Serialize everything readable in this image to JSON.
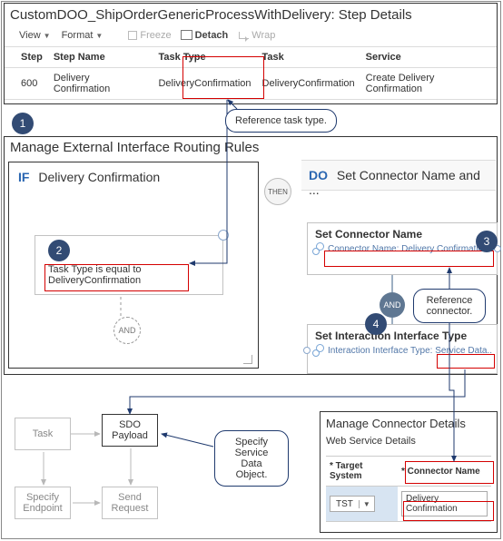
{
  "top": {
    "title": "CustomDOO_ShipOrderGenericProcessWithDelivery: Step Details",
    "toolbar": {
      "view": "View",
      "format": "Format",
      "freeze": "Freeze",
      "detach": "Detach",
      "wrap": "Wrap"
    },
    "table": {
      "headers": {
        "step": "Step",
        "step_name": "Step Name",
        "task_type": "Task Type",
        "task": "Task",
        "service": "Service"
      },
      "row": {
        "step": "600",
        "step_name": "Delivery Confirmation",
        "task_type": "DeliveryConfirmation",
        "task": "DeliveryConfirmation",
        "service": "Create Delivery Confirmation"
      }
    }
  },
  "callouts": {
    "ref_task_type": "Reference  task type.",
    "ref_connector": "Reference connector.",
    "specify_sdo": "Specify Service Data Object."
  },
  "routing": {
    "title": "Manage External Interface Routing Rules",
    "if_label": "IF",
    "if_title": "Delivery Confirmation",
    "if_clause": "Task Type is equal to DeliveryConfirmation",
    "then_label": "THEN",
    "do_label": "DO",
    "do_title": "Set Connector Name and ...",
    "and_label": "AND",
    "set_connector": {
      "title": "Set Connector Name",
      "line": "Connector Name: Delivery Confirmatio..."
    },
    "set_interaction": {
      "title": "Set Interaction Interface Type",
      "line_prefix": "Interaction Interface Type:",
      "line_value": "Service Data..."
    }
  },
  "badges": {
    "b1": "1",
    "b2": "2",
    "b3": "3",
    "b4": "4"
  },
  "flow": {
    "task": "Task",
    "sdo": "SDO Payload",
    "specify_endpoint": "Specify Endpoint",
    "send_request": "Send Request"
  },
  "connector_details": {
    "title": "Manage Connector Details",
    "subtitle": "Web Service Details",
    "headers": {
      "target_system": "Target System",
      "connector_name": "Connector Name"
    },
    "row": {
      "target_system": "TST",
      "connector_name": "Delivery Confirmation"
    }
  }
}
